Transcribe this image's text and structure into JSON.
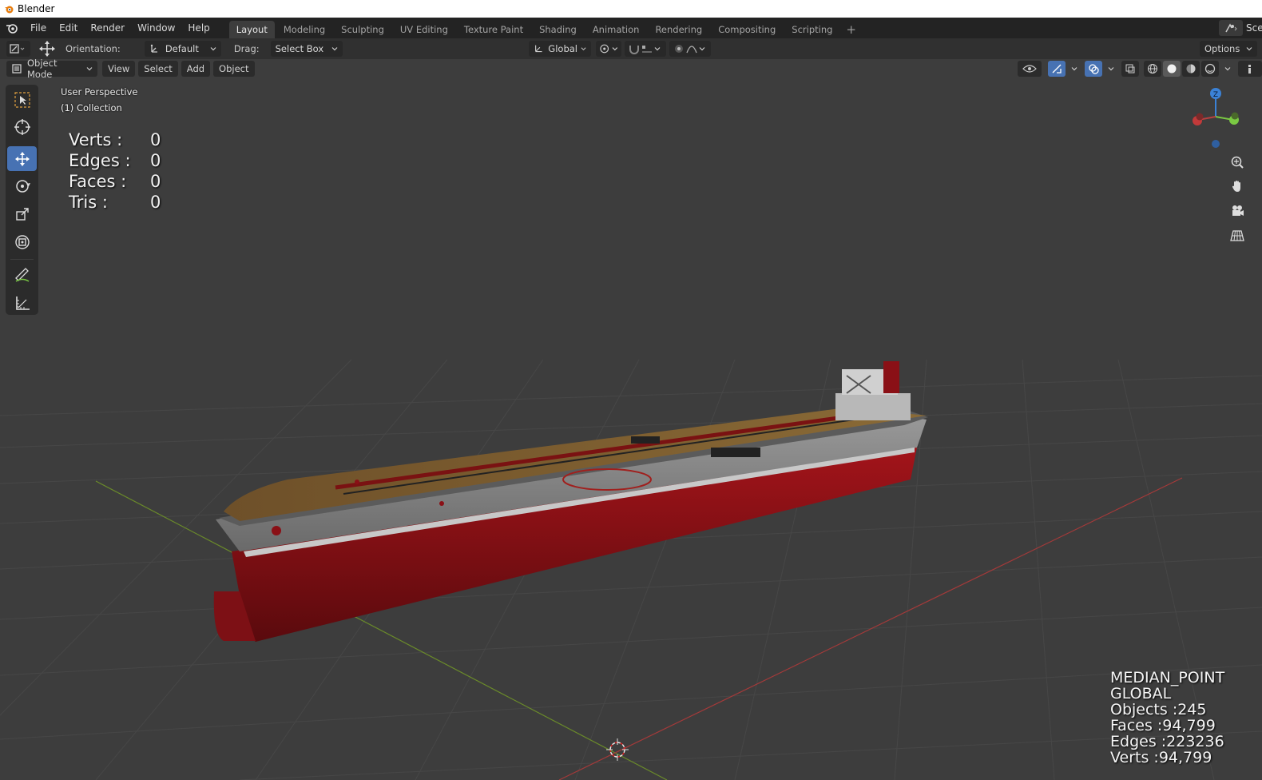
{
  "window": {
    "title": "Blender"
  },
  "menu": {
    "items": [
      "File",
      "Edit",
      "Render",
      "Window",
      "Help"
    ]
  },
  "workspaces": {
    "tabs": [
      "Layout",
      "Modeling",
      "Sculpting",
      "UV Editing",
      "Texture Paint",
      "Shading",
      "Animation",
      "Rendering",
      "Compositing",
      "Scripting"
    ],
    "active": "Layout",
    "add_label": "+"
  },
  "scene": {
    "label": "Sce"
  },
  "tool_header": {
    "orientation_label": "Orientation:",
    "orientation_value": "Default",
    "drag_label": "Drag:",
    "drag_value": "Select Box",
    "transform_orientation": "Global",
    "options_label": "Options"
  },
  "viewport_header": {
    "mode": "Object Mode",
    "menus": [
      "View",
      "Select",
      "Add",
      "Object"
    ]
  },
  "viewport": {
    "perspective_label": "User Perspective",
    "collection_label": "(1) Collection",
    "stats": [
      {
        "key": "Verts :",
        "value": "0"
      },
      {
        "key": "Edges :",
        "value": "0"
      },
      {
        "key": "Faces :",
        "value": "0"
      },
      {
        "key": "Tris :",
        "value": "0"
      }
    ],
    "bottom_right": [
      "MEDIAN_POINT",
      "GLOBAL",
      "Objects :245",
      "Faces :94,799",
      "Edges :223236",
      "Verts :94,799"
    ],
    "gizmo_axis_label": "Z"
  },
  "tools": [
    "select-box",
    "cursor",
    "move",
    "rotate",
    "scale",
    "transform",
    "annotate",
    "measure"
  ],
  "colors": {
    "accent": "#4772b3",
    "hull_red": "#8b0f14",
    "deck": "#7a5a2e",
    "grid_x": "#a33a3a",
    "grid_y": "#6a8a2a"
  }
}
